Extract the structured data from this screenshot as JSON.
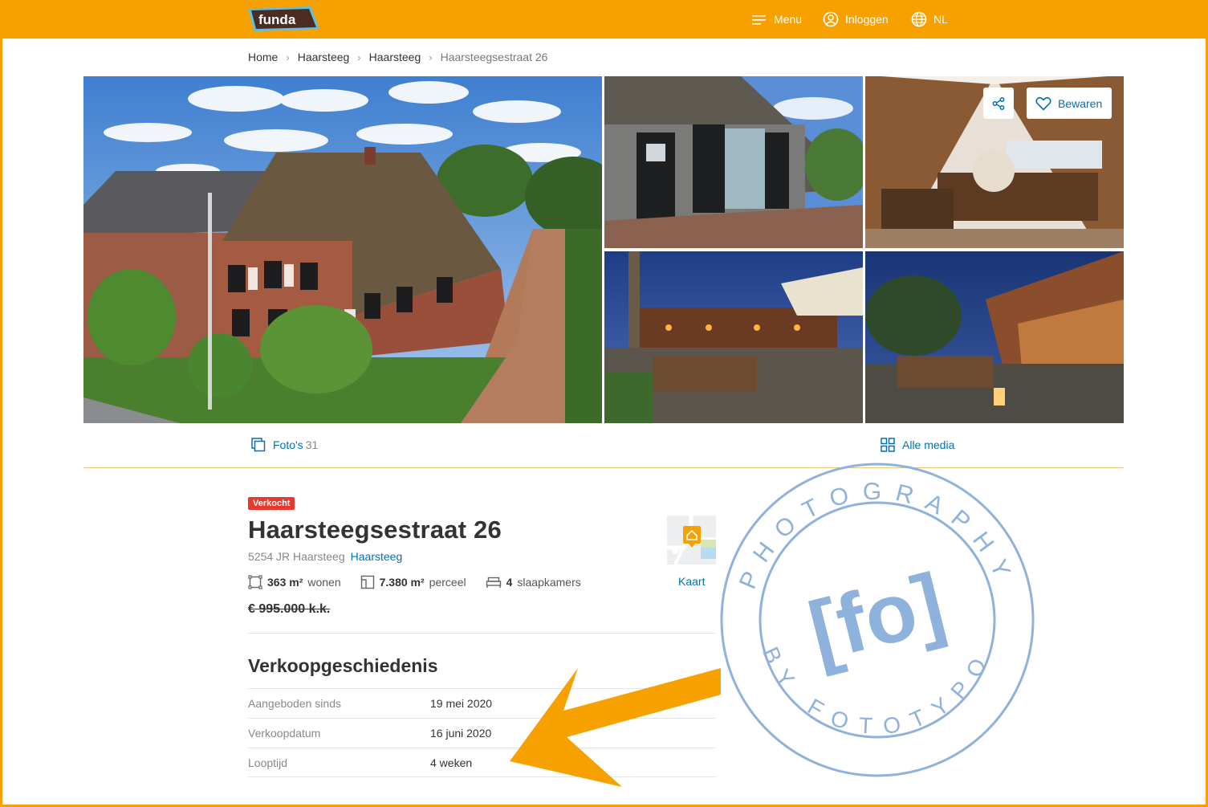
{
  "header": {
    "logo_text": "funda",
    "menu_label": "Menu",
    "login_label": "Inloggen",
    "language_label": "NL"
  },
  "breadcrumb": [
    "Home",
    "Haarsteeg",
    "Haarsteeg",
    "Haarsteegsestraat 26"
  ],
  "gallery": {
    "save_label": "Bewaren",
    "photos_label": "Foto's",
    "photos_count": "31",
    "all_media_label": "Alle media"
  },
  "listing": {
    "status_badge": "Verkocht",
    "title": "Haarsteegsestraat 26",
    "postcode_city": "5254 JR Haarsteeg",
    "city_link": "Haarsteeg",
    "features": {
      "living_value": "363 m²",
      "living_label": "wonen",
      "plot_value": "7.380 m²",
      "plot_label": "perceel",
      "bedrooms_value": "4",
      "bedrooms_label": "slaapkamers"
    },
    "price": "€ 995.000 k.k.",
    "map_label": "Kaart"
  },
  "sales_history": {
    "title": "Verkoopgeschiedenis",
    "rows": [
      {
        "label": "Aangeboden sinds",
        "value": "19 mei 2020"
      },
      {
        "label": "Verkoopdatum",
        "value": "16 juni 2020"
      },
      {
        "label": "Looptijd",
        "value": "4 weken"
      }
    ]
  },
  "watermark": {
    "top_text": "PHOTOGRAPHY",
    "center_text": "[fo]",
    "bottom_text": "BY FOTOTYPO"
  },
  "colors": {
    "brand_orange": "#f7a100",
    "link_blue": "#0071b3",
    "sold_red": "#e8392c",
    "stamp_blue": "#8fb2dc"
  },
  "icons": [
    "menu-icon",
    "user-icon",
    "globe-icon",
    "share-icon",
    "heart-icon",
    "photos-icon",
    "grid-icon",
    "area-icon",
    "plot-icon",
    "bed-icon",
    "map-pin-icon"
  ]
}
